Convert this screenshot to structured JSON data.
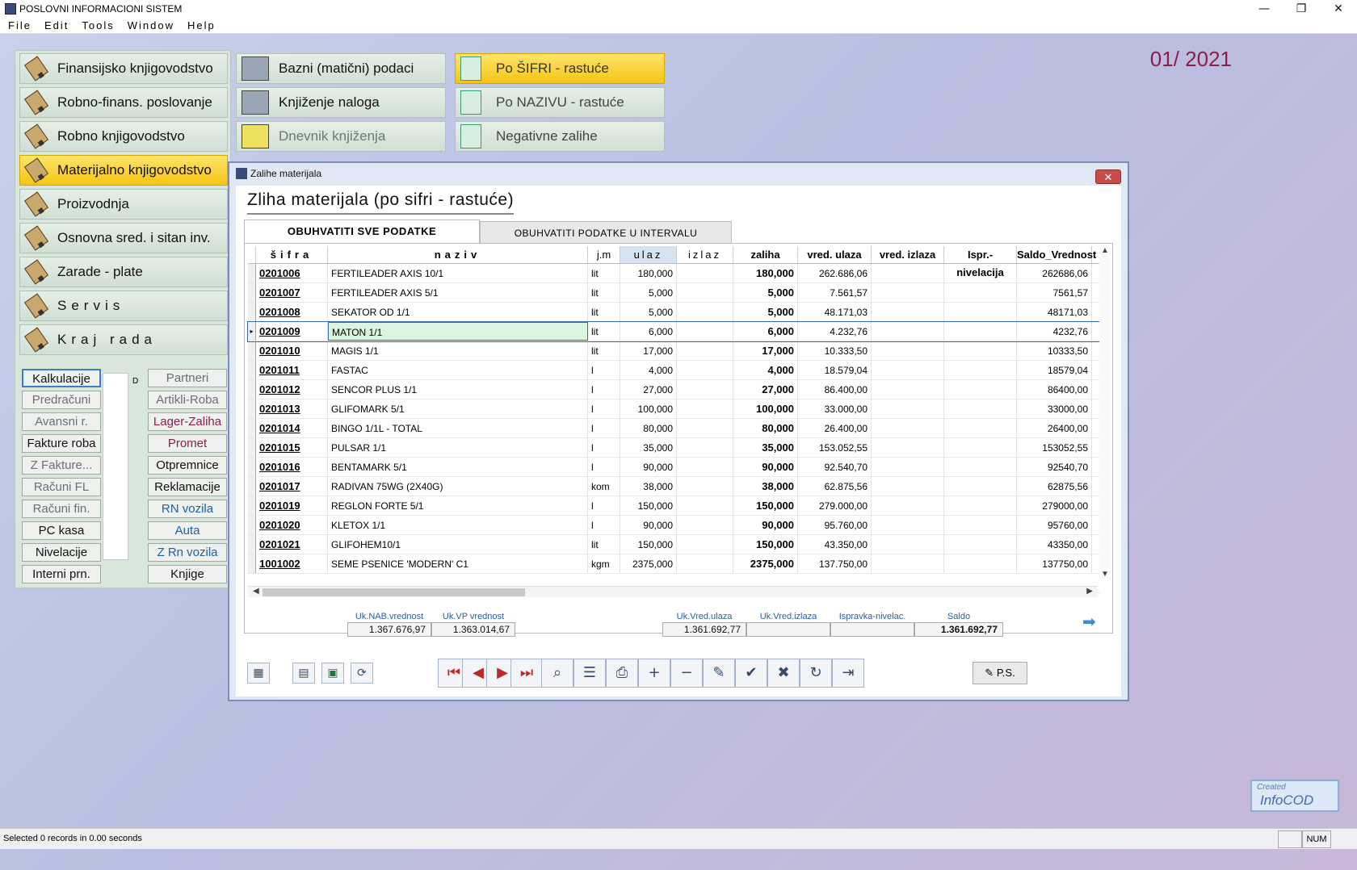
{
  "app": {
    "title": "POSLOVNI INFORMACIONI SISTEM",
    "menu": [
      "File",
      "Edit",
      "Tools",
      "Window",
      "Help"
    ],
    "period": "01/ 2021"
  },
  "modules": [
    {
      "label": "Finansijsko knjigovodstvo",
      "active": false
    },
    {
      "label": "Robno-finans. poslovanje",
      "active": false
    },
    {
      "label": "Robno knjigovodstvo",
      "active": false
    },
    {
      "label": "Materijalno knjigovodstvo",
      "active": true
    },
    {
      "label": "Proizvodnja",
      "active": false
    },
    {
      "label": "Osnovna sred. i sitan inv.",
      "active": false
    },
    {
      "label": "Zarade - plate",
      "active": false
    },
    {
      "label": "Servis",
      "active": false
    },
    {
      "label": "Kraj rada",
      "active": false
    }
  ],
  "submenu": [
    {
      "label": "Bazni (matični) podaci"
    },
    {
      "label": "Knjiženje naloga"
    },
    {
      "label": "Dnevnik knjiženja"
    }
  ],
  "orders": [
    {
      "label": "Po ŠIFRI - rastuće",
      "active": true
    },
    {
      "label": "Po NAZIVU - rastuće",
      "active": false
    },
    {
      "label": "Negativne zalihe",
      "active": false
    }
  ],
  "small_buttons": {
    "left": [
      "Kalkulacije",
      "Predračuni",
      "Avansni r.",
      "Fakture roba",
      "Z Fakture...",
      "Računi FL",
      "Računi fin.",
      "PC kasa",
      "Nivelacije",
      "Interni prn."
    ],
    "right": [
      "Partneri",
      "Artikli-Roba",
      "Lager-Zaliha",
      "Promet",
      "Otpremnice",
      "Reklamacije",
      "RN vozila",
      "Auta",
      "Z Rn vozila",
      "Knjige"
    ],
    "sheet_letter": "D"
  },
  "window": {
    "title": "Zalihe materijala",
    "report_title": "Zliha materijala (po sifri - rastuće)",
    "tabs": [
      "OBUHVATITI SVE PODATKE",
      "OBUHVATITI PODATKE U INTERVALU"
    ],
    "columns": [
      "šifra",
      "naziv",
      "j.m",
      "ulaz",
      "izlaz",
      "zaliha",
      "vred. ulaza",
      "vred. izlaza",
      "Ispr.-nivelacija",
      "Saldo_Vrednost"
    ],
    "rows": [
      {
        "code": "0201006",
        "name": "FERTILEADER AXIS 10/1",
        "jm": "lit",
        "ulaz": "180,000",
        "izlaz": "",
        "zaliha": "180,000",
        "vred_ulaza": "262.686,06",
        "vred_izlaza": "",
        "ispr": "",
        "saldo": "262686,06"
      },
      {
        "code": "0201007",
        "name": "FERTILEADER AXIS 5/1",
        "jm": "lit",
        "ulaz": "5,000",
        "izlaz": "",
        "zaliha": "5,000",
        "vred_ulaza": "7.561,57",
        "vred_izlaza": "",
        "ispr": "",
        "saldo": "7561,57"
      },
      {
        "code": "0201008",
        "name": "SEKATOR OD 1/1",
        "jm": "lit",
        "ulaz": "5,000",
        "izlaz": "",
        "zaliha": "5,000",
        "vred_ulaza": "48.171,03",
        "vred_izlaza": "",
        "ispr": "",
        "saldo": "48171,03"
      },
      {
        "code": "0201009",
        "name": "MATON 1/1",
        "jm": "lit",
        "ulaz": "6,000",
        "izlaz": "",
        "zaliha": "6,000",
        "vred_ulaza": "4.232,76",
        "vred_izlaza": "",
        "ispr": "",
        "saldo": "4232,76"
      },
      {
        "code": "0201010",
        "name": "MAGIS 1/1",
        "jm": "lit",
        "ulaz": "17,000",
        "izlaz": "",
        "zaliha": "17,000",
        "vred_ulaza": "10.333,50",
        "vred_izlaza": "",
        "ispr": "",
        "saldo": "10333,50"
      },
      {
        "code": "0201011",
        "name": "FASTAC",
        "jm": "l",
        "ulaz": "4,000",
        "izlaz": "",
        "zaliha": "4,000",
        "vred_ulaza": "18.579,04",
        "vred_izlaza": "",
        "ispr": "",
        "saldo": "18579,04"
      },
      {
        "code": "0201012",
        "name": "SENCOR PLUS 1/1",
        "jm": "l",
        "ulaz": "27,000",
        "izlaz": "",
        "zaliha": "27,000",
        "vred_ulaza": "86.400,00",
        "vred_izlaza": "",
        "ispr": "",
        "saldo": "86400,00"
      },
      {
        "code": "0201013",
        "name": "GLIFOMARK 5/1",
        "jm": "l",
        "ulaz": "100,000",
        "izlaz": "",
        "zaliha": "100,000",
        "vred_ulaza": "33.000,00",
        "vred_izlaza": "",
        "ispr": "",
        "saldo": "33000,00"
      },
      {
        "code": "0201014",
        "name": "BINGO 1/1L - TOTAL",
        "jm": "l",
        "ulaz": "80,000",
        "izlaz": "",
        "zaliha": "80,000",
        "vred_ulaza": "26.400,00",
        "vred_izlaza": "",
        "ispr": "",
        "saldo": "26400,00"
      },
      {
        "code": "0201015",
        "name": "PULSAR 1/1",
        "jm": "l",
        "ulaz": "35,000",
        "izlaz": "",
        "zaliha": "35,000",
        "vred_ulaza": "153.052,55",
        "vred_izlaza": "",
        "ispr": "",
        "saldo": "153052,55"
      },
      {
        "code": "0201016",
        "name": "BENTAMARK 5/1",
        "jm": "l",
        "ulaz": "90,000",
        "izlaz": "",
        "zaliha": "90,000",
        "vred_ulaza": "92.540,70",
        "vred_izlaza": "",
        "ispr": "",
        "saldo": "92540,70"
      },
      {
        "code": "0201017",
        "name": "RADIVAN 75WG (2X40G)",
        "jm": "kom",
        "ulaz": "38,000",
        "izlaz": "",
        "zaliha": "38,000",
        "vred_ulaza": "62.875,56",
        "vred_izlaza": "",
        "ispr": "",
        "saldo": "62875,56"
      },
      {
        "code": "0201019",
        "name": "REGLON FORTE 5/1",
        "jm": "l",
        "ulaz": "150,000",
        "izlaz": "",
        "zaliha": "150,000",
        "vred_ulaza": "279.000,00",
        "vred_izlaza": "",
        "ispr": "",
        "saldo": "279000,00"
      },
      {
        "code": "0201020",
        "name": "KLETOX 1/1",
        "jm": "l",
        "ulaz": "90,000",
        "izlaz": "",
        "zaliha": "90,000",
        "vred_ulaza": "95.760,00",
        "vred_izlaza": "",
        "ispr": "",
        "saldo": "95760,00"
      },
      {
        "code": "0201021",
        "name": "GLIFOHEM10/1",
        "jm": "lit",
        "ulaz": "150,000",
        "izlaz": "",
        "zaliha": "150,000",
        "vred_ulaza": "43.350,00",
        "vred_izlaza": "",
        "ispr": "",
        "saldo": "43350,00"
      },
      {
        "code": "1001002",
        "name": "SEME PSENICE 'MODERN' C1",
        "jm": "kgm",
        "ulaz": "2375,000",
        "izlaz": "",
        "zaliha": "2375,000",
        "vred_ulaza": "137.750,00",
        "vred_izlaza": "",
        "ispr": "",
        "saldo": "137750,00"
      }
    ],
    "current_row": 3,
    "summary": {
      "nab_label": "Uk.NAB.vrednost",
      "nab_value": "1.367.676,97",
      "vp_label": "Uk.VP vrednost",
      "vp_value": "1.363.014,67",
      "vu_label": "Uk.Vred.ulaza",
      "vu_value": "1.361.692,77",
      "vi_label": "Uk.Vred.izlaza",
      "vi_value": "",
      "isp_label": "Ispravka-nivelac.",
      "isp_value": "",
      "saldo_label": "Saldo",
      "saldo_value": "1.361.692,77"
    },
    "ps_label": "P.S."
  },
  "logo": {
    "line1": "Created",
    "line2": "InfoCOD"
  },
  "status": {
    "text": "Selected 0 records in 0.00 seconds",
    "num": "NUM"
  }
}
